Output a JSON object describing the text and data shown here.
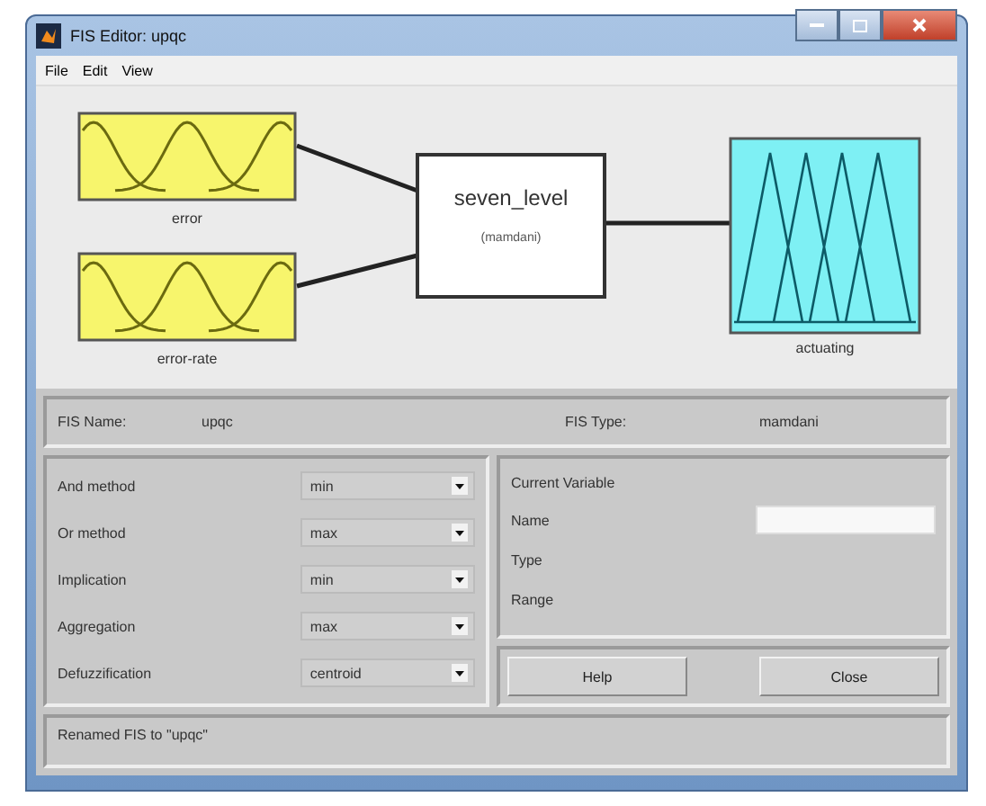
{
  "window": {
    "title": "FIS Editor: upqc"
  },
  "menu": [
    "File",
    "Edit",
    "View"
  ],
  "diagram": {
    "inputs": [
      {
        "name": "error"
      },
      {
        "name": "error-rate"
      }
    ],
    "system": {
      "name": "seven_level",
      "type": "(mamdani)"
    },
    "outputs": [
      {
        "name": "actuating"
      }
    ]
  },
  "fis": {
    "name_label": "FIS Name:",
    "name": "upqc",
    "type_label": "FIS Type:",
    "type": "mamdani"
  },
  "methods": [
    {
      "label": "And method",
      "value": "min"
    },
    {
      "label": "Or method",
      "value": "max"
    },
    {
      "label": "Implication",
      "value": "min"
    },
    {
      "label": "Aggregation",
      "value": "max"
    },
    {
      "label": "Defuzzification",
      "value": "centroid"
    }
  ],
  "current_variable": {
    "title": "Current Variable",
    "fields": [
      {
        "label": "Name",
        "kind": "input"
      },
      {
        "label": "Type",
        "kind": "text"
      },
      {
        "label": "Range",
        "kind": "text"
      }
    ]
  },
  "buttons": [
    "Help",
    "Close"
  ],
  "status": "Renamed FIS to \"upqc\""
}
